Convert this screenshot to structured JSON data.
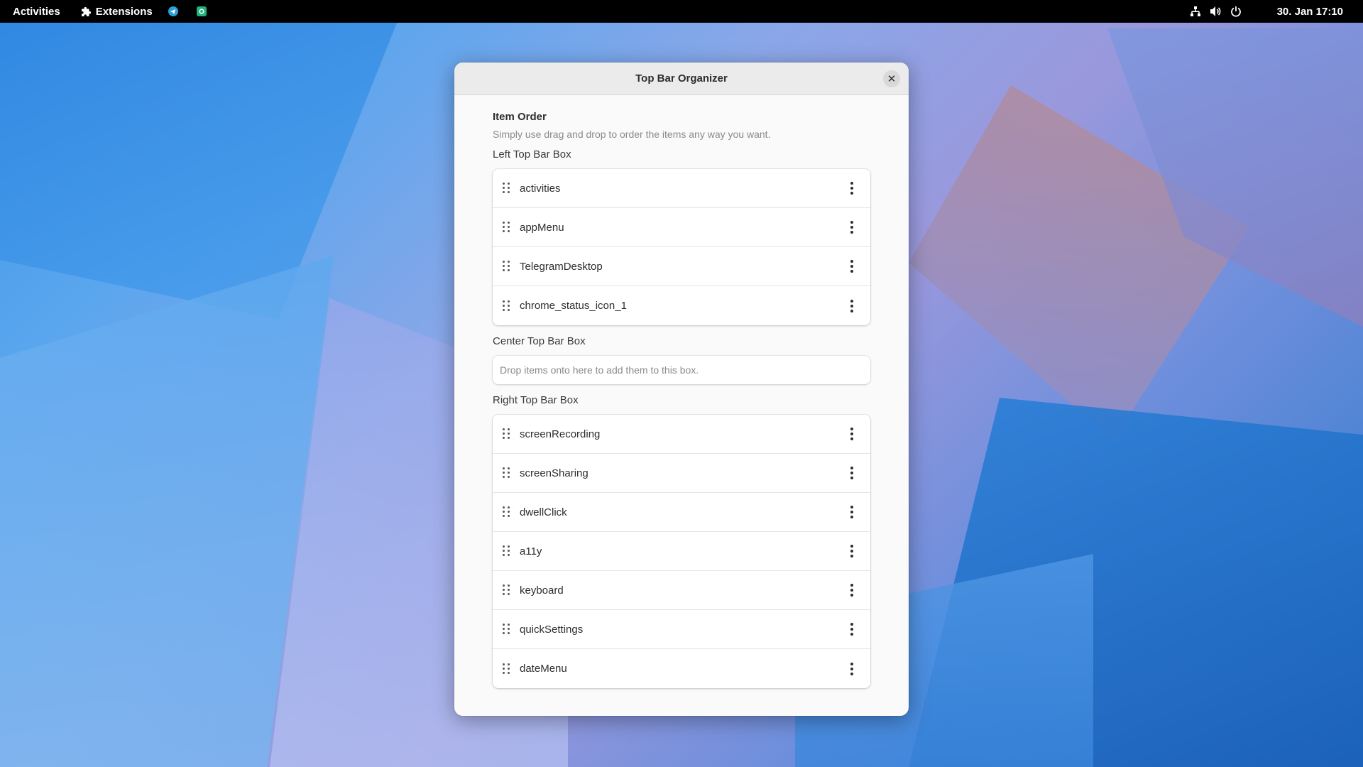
{
  "topbar": {
    "activities": "Activities",
    "extensions": "Extensions",
    "tray_icons": [
      {
        "name": "telegram-icon",
        "color": "#2aa1da"
      },
      {
        "name": "chrome-status-icon",
        "color": "#1fb57a"
      }
    ],
    "system_icons": [
      "network-icon",
      "volume-icon",
      "power-icon"
    ],
    "clock": "30. Jan  17:10"
  },
  "dialog": {
    "title": "Top Bar Organizer",
    "close_symbol": "✕",
    "section_title": "Item Order",
    "section_desc": "Simply use drag and drop to order the items any way you want.",
    "left_box": {
      "label": "Left Top Bar Box",
      "items": [
        "activities",
        "appMenu",
        "TelegramDesktop",
        "chrome_status_icon_1"
      ]
    },
    "center_box": {
      "label": "Center Top Bar Box",
      "placeholder": "Drop items onto here to add them to this box."
    },
    "right_box": {
      "label": "Right Top Bar Box",
      "items": [
        "screenRecording",
        "screenSharing",
        "dwellClick",
        "a11y",
        "keyboard",
        "quickSettings",
        "dateMenu"
      ]
    }
  },
  "colors": {
    "topbar_bg": "#000000",
    "dialog_bg": "#fafafa",
    "header_bg": "#ebebeb"
  }
}
